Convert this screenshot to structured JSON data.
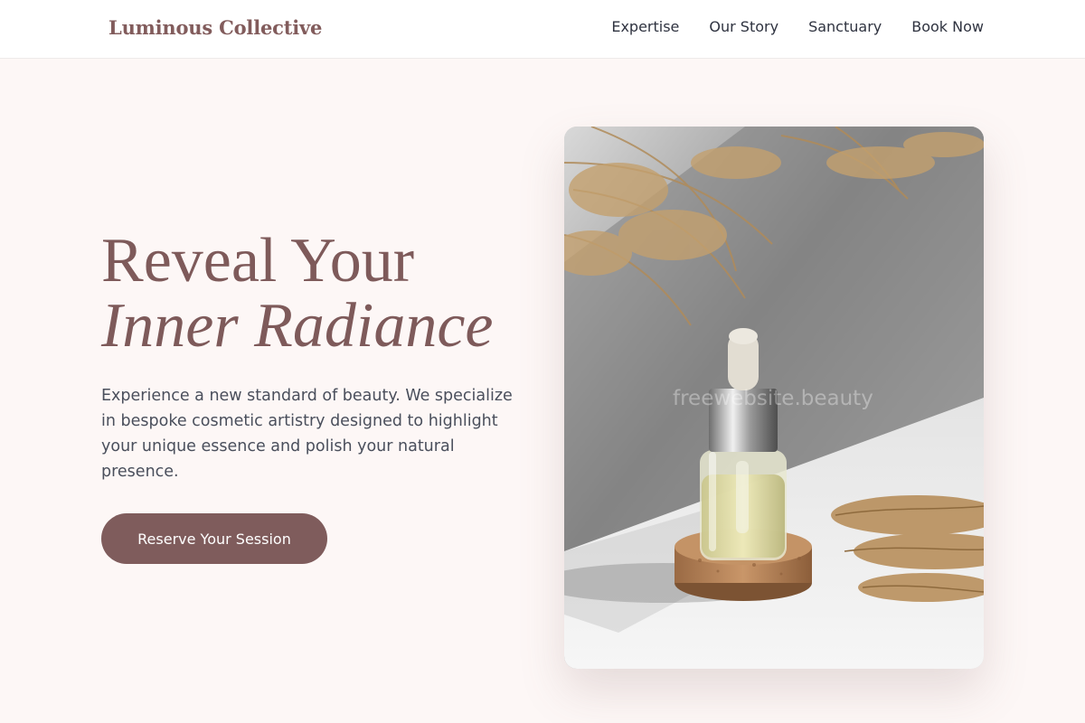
{
  "header": {
    "brand": "Luminous Collective",
    "nav": [
      "Expertise",
      "Our Story",
      "Sanctuary",
      "Book Now"
    ]
  },
  "hero": {
    "title_line1": "Reveal Your",
    "title_line2": "Inner Radiance",
    "description": "Experience a new standard of beauty. We specialize in bespoke cosmetic artistry designed to highlight your unique essence and polish your natural presence.",
    "cta_label": "Reserve Your Session",
    "image_watermark": "freewebsite.beauty"
  },
  "colors": {
    "accent": "#7f5c5c",
    "page_bg": "#fdf7f6",
    "body_text": "#4a4f5c"
  }
}
